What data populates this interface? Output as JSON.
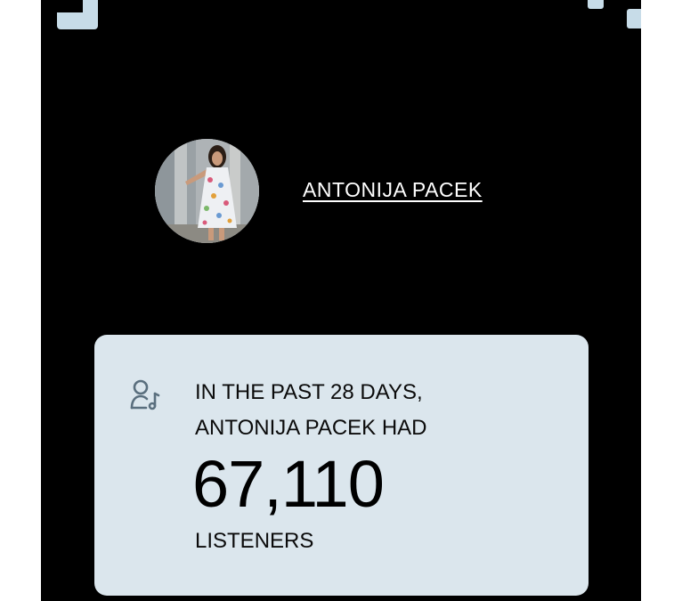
{
  "artist": {
    "name": "ANTONIJA PACEK",
    "avatar_icon": "artist-photo"
  },
  "stats": {
    "intro_line1": "IN THE PAST 28 DAYS,",
    "intro_line2": "ANTONIJA PACEK HAD",
    "value": "67,110",
    "unit": "LISTENERS",
    "icon": "listener-icon"
  },
  "colors": {
    "background": "#000000",
    "card": "#dbe6ed",
    "corner_accent": "#c7dce8",
    "text_light": "#ffffff",
    "text_dark": "#000000",
    "icon": "#5a6f7e"
  }
}
